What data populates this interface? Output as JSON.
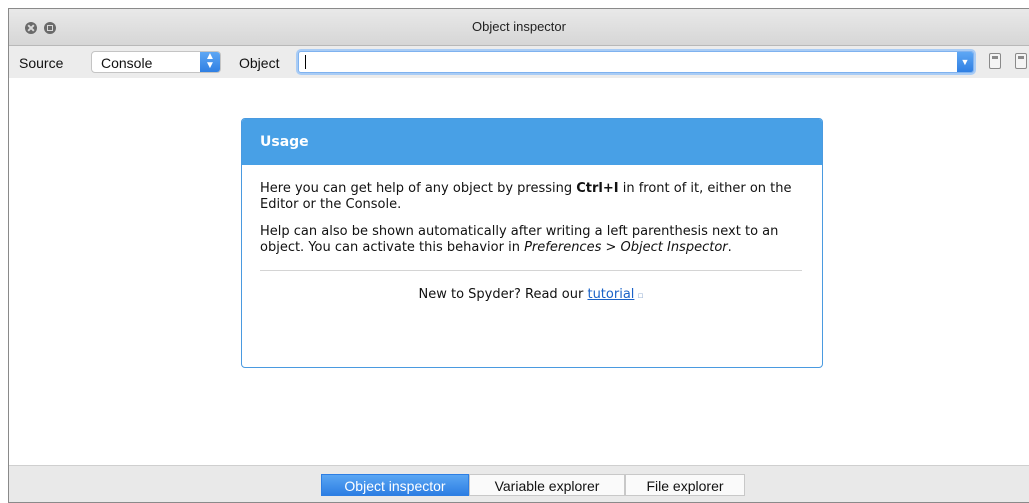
{
  "window": {
    "title": "Object inspector"
  },
  "toolbar": {
    "source_label": "Source",
    "source_value": "Console",
    "object_label": "Object",
    "object_value": ""
  },
  "usage": {
    "title": "Usage",
    "p1_before": "Here you can get help of any object by pressing ",
    "p1_shortcut": "Ctrl+I",
    "p1_after": " in front of it, either on the Editor or the Console.",
    "p2_before": "Help can also be shown automatically after writing a left parenthesis next to an object. You can activate this behavior in ",
    "p2_path": "Preferences > Object Inspector",
    "p2_after": ".",
    "footer_text": "New to Spyder? Read our ",
    "footer_link": "tutorial"
  },
  "tabs": [
    {
      "label": "Object inspector",
      "active": true
    },
    {
      "label": "Variable explorer",
      "active": false
    },
    {
      "label": "File explorer",
      "active": false
    }
  ],
  "colors": {
    "accent": "#48a0e6",
    "link": "#1a62c7"
  }
}
